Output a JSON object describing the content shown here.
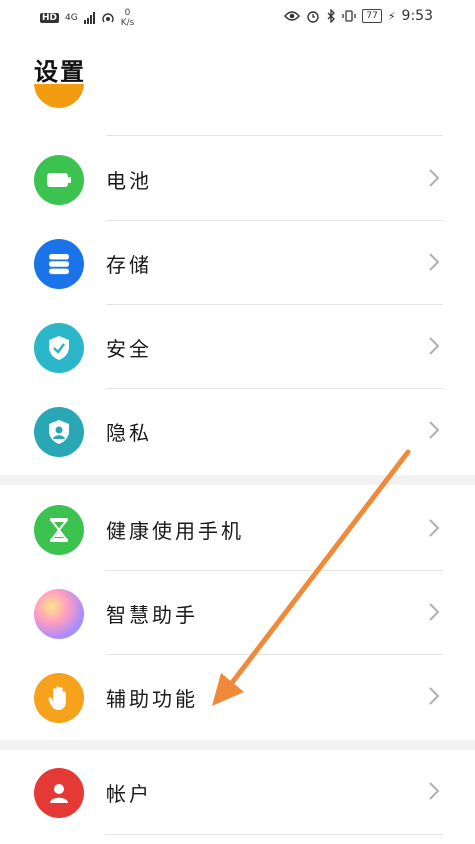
{
  "status": {
    "hd": "HD",
    "network": "4G",
    "speed_value": "0",
    "speed_unit": "K/s",
    "battery": "77",
    "time": "9:53"
  },
  "header": {
    "title": "设置"
  },
  "rows": [
    {
      "label": "电池"
    },
    {
      "label": "存储"
    },
    {
      "label": "安全"
    },
    {
      "label": "隐私"
    },
    {
      "label": "健康使用手机"
    },
    {
      "label": "智慧助手"
    },
    {
      "label": "辅助功能"
    },
    {
      "label": "帐户"
    }
  ],
  "colors": {
    "partial": "#f39c12",
    "battery": "#3cc24f",
    "storage": "#1a73e8",
    "security": "#2bb7c9",
    "privacy": "#2aa7b5",
    "health": "#3cc24f",
    "assistant": "#c98be8",
    "accessibility": "#f6a21a",
    "account": "#e53935",
    "annotation_arrow": "#f08a3a"
  }
}
